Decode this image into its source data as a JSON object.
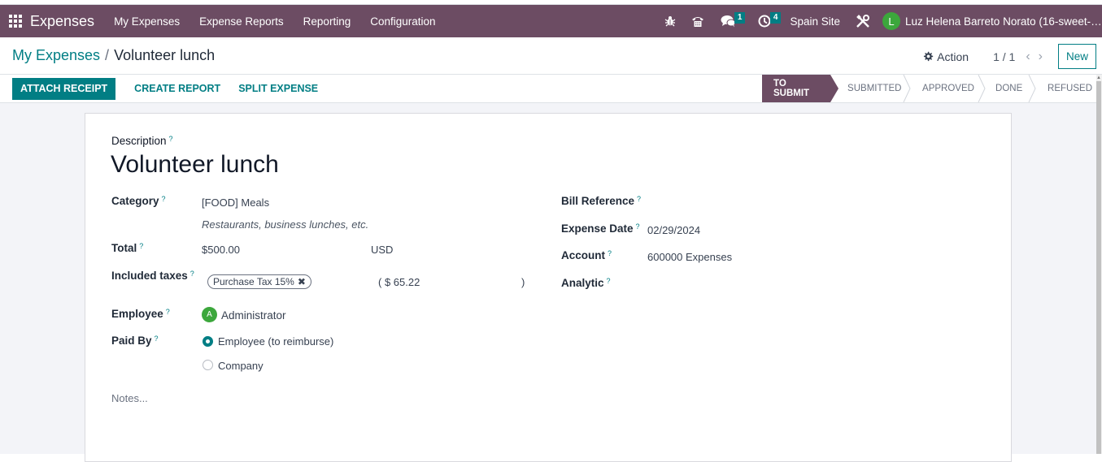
{
  "navbar": {
    "app_name": "Expenses",
    "menu": [
      "My Expenses",
      "Expense Reports",
      "Reporting",
      "Configuration"
    ],
    "icons": [
      "bug-icon",
      "phone-icon",
      "chat-icon",
      "clock-icon"
    ],
    "messages_count": "1",
    "activities_count": "4",
    "company": "Spain Site",
    "user_initial": "L",
    "user_name": "Luz Helena Barreto Norato (16-sweet-b..."
  },
  "control": {
    "breadcrumb_parent": "My Expenses",
    "breadcrumb_separator": "/",
    "breadcrumb_current": "Volunteer lunch",
    "action_label": "Action",
    "pager": "1 / 1",
    "prev": "‹",
    "next": "›",
    "new_label": "New"
  },
  "statusbar": {
    "buttons": [
      "ATTACH RECEIPT",
      "CREATE REPORT",
      "SPLIT EXPENSE"
    ],
    "stages": [
      "TO SUBMIT",
      "SUBMITTED",
      "APPROVED",
      "DONE",
      "REFUSED"
    ],
    "active_stage": "TO SUBMIT"
  },
  "form": {
    "help_mark": "?",
    "description_label": "Description",
    "description": "Volunteer lunch",
    "category_label": "Category",
    "category": "[FOOD] Meals",
    "category_note": "Restaurants, business lunches, etc.",
    "total_label": "Total",
    "total": "$500.00",
    "currency": "USD",
    "taxes_label": "Included taxes",
    "tax_tag": "Purchase Tax 15%",
    "tax_remove": "✖",
    "tax_amount_open": "( $ 65.22",
    "tax_amount_close": ")",
    "employee_label": "Employee",
    "employee_initial": "A",
    "employee": "Administrator",
    "paid_by_label": "Paid By",
    "paid_by_options": [
      "Employee (to reimburse)",
      "Company"
    ],
    "paid_by_selected": "Employee (to reimburse)",
    "bill_reference_label": "Bill Reference",
    "bill_reference": "",
    "expense_date_label": "Expense Date",
    "expense_date": "02/29/2024",
    "account_label": "Account",
    "account": "600000 Expenses",
    "analytic_label": "Analytic",
    "notes_placeholder": "Notes..."
  },
  "colors": {
    "brand": "#6c4c63",
    "accent": "#017e84",
    "avatar_green": "#3ca73c"
  }
}
